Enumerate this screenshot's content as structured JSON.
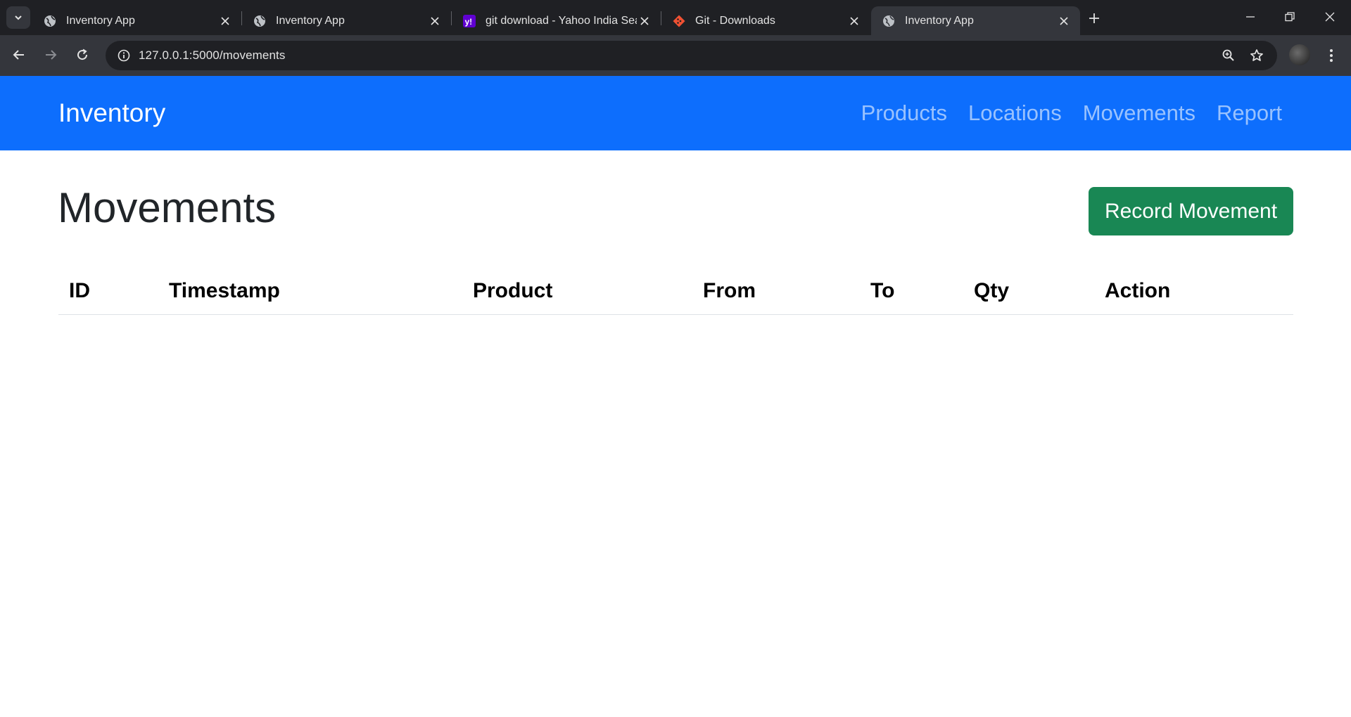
{
  "browser": {
    "tabs": [
      {
        "title": "Inventory App",
        "icon": "globe-icon",
        "active": false
      },
      {
        "title": "Inventory App",
        "icon": "globe-icon",
        "active": false
      },
      {
        "title": "git download - Yahoo India Search",
        "icon": "yahoo-icon",
        "active": false
      },
      {
        "title": "Git - Downloads",
        "icon": "git-icon",
        "active": false
      },
      {
        "title": "Inventory App",
        "icon": "globe-icon",
        "active": true
      }
    ],
    "url": "127.0.0.1:5000/movements"
  },
  "app": {
    "brand": "Inventory",
    "nav": [
      "Products",
      "Locations",
      "Movements",
      "Report"
    ],
    "page_title": "Movements",
    "record_button": "Record Movement",
    "table": {
      "columns": [
        "ID",
        "Timestamp",
        "Product",
        "From",
        "To",
        "Qty",
        "Action"
      ],
      "rows": []
    }
  },
  "colors": {
    "navbar": "#0d6efd",
    "record_button": "#198754",
    "chrome_dark": "#1f2024",
    "chrome_toolbar": "#34363c"
  }
}
